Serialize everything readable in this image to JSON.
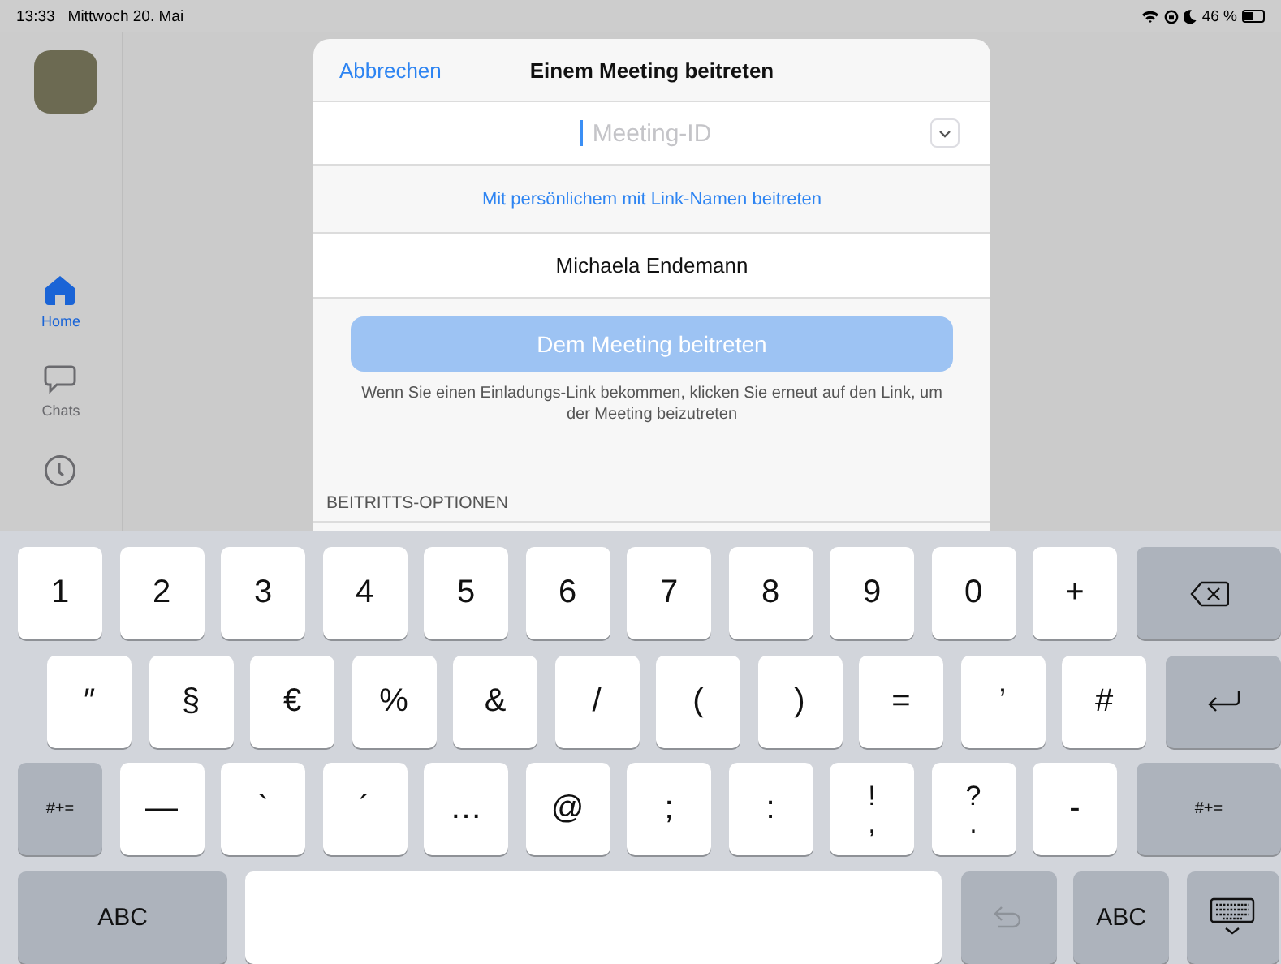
{
  "status_bar": {
    "time": "13:33",
    "date": "Mittwoch 20. Mai",
    "battery": "46 %"
  },
  "sidebar": {
    "items": [
      {
        "kind": "home",
        "label": "Home",
        "selected": true
      },
      {
        "kind": "chats",
        "label": "Chats",
        "selected": false
      },
      {
        "kind": "recent",
        "selected": false
      }
    ]
  },
  "dialog": {
    "cancel": "Abbrechen",
    "title": "Einem Meeting beitreten",
    "meeting_id": {
      "placeholder": "Meeting-ID",
      "focused": true
    },
    "link": "Mit persönlichem mit Link-Namen beitreten",
    "name": {
      "value": "Michaela Endemann"
    },
    "join_button": {
      "label": "Dem Meeting beitreten",
      "disabled": true
    },
    "hint": "Wenn Sie einen Einladungs-Link bekommen, klicken Sie erneut auf den Link, um der Meeting beizutreten",
    "section": "BEITRITTS-OPTIONEN"
  },
  "keyboard": {
    "rows": [
      [
        {
          "kind": "char",
          "label": "1"
        },
        {
          "kind": "char",
          "label": "2"
        },
        {
          "kind": "char",
          "label": "3"
        },
        {
          "kind": "char",
          "label": "4"
        },
        {
          "kind": "char",
          "label": "5"
        },
        {
          "kind": "char",
          "label": "6"
        },
        {
          "kind": "char",
          "label": "7"
        },
        {
          "kind": "char",
          "label": "8"
        },
        {
          "kind": "char",
          "label": "9"
        },
        {
          "kind": "char",
          "label": "0"
        },
        {
          "kind": "char",
          "label": "+"
        },
        {
          "kind": "delete"
        }
      ],
      [
        {
          "kind": "char",
          "label": "″"
        },
        {
          "kind": "char",
          "label": "§"
        },
        {
          "kind": "char",
          "label": "€"
        },
        {
          "kind": "char",
          "label": "%"
        },
        {
          "kind": "char",
          "label": "&"
        },
        {
          "kind": "char",
          "label": "/"
        },
        {
          "kind": "char",
          "label": "("
        },
        {
          "kind": "char",
          "label": ")"
        },
        {
          "kind": "char",
          "label": "="
        },
        {
          "kind": "char",
          "label": "’"
        },
        {
          "kind": "char",
          "label": "#"
        },
        {
          "kind": "return"
        }
      ],
      [
        {
          "kind": "mod",
          "label": "#+="
        },
        {
          "kind": "char",
          "label": "—"
        },
        {
          "kind": "char",
          "label": "`"
        },
        {
          "kind": "char",
          "label": "´"
        },
        {
          "kind": "char",
          "label": "…"
        },
        {
          "kind": "char",
          "label": "@"
        },
        {
          "kind": "char",
          "label": ";"
        },
        {
          "kind": "char",
          "label": ":"
        },
        {
          "kind": "char",
          "label": "!",
          "sub": ","
        },
        {
          "kind": "char",
          "label": "?",
          "sub": "."
        },
        {
          "kind": "char",
          "label": "-"
        },
        {
          "kind": "mod",
          "label": "#+="
        }
      ],
      [
        {
          "kind": "mod",
          "label": "ABC"
        },
        {
          "kind": "space"
        },
        {
          "kind": "undo",
          "disabled": true
        },
        {
          "kind": "mod",
          "label": "ABC"
        },
        {
          "kind": "dismiss"
        }
      ]
    ]
  }
}
